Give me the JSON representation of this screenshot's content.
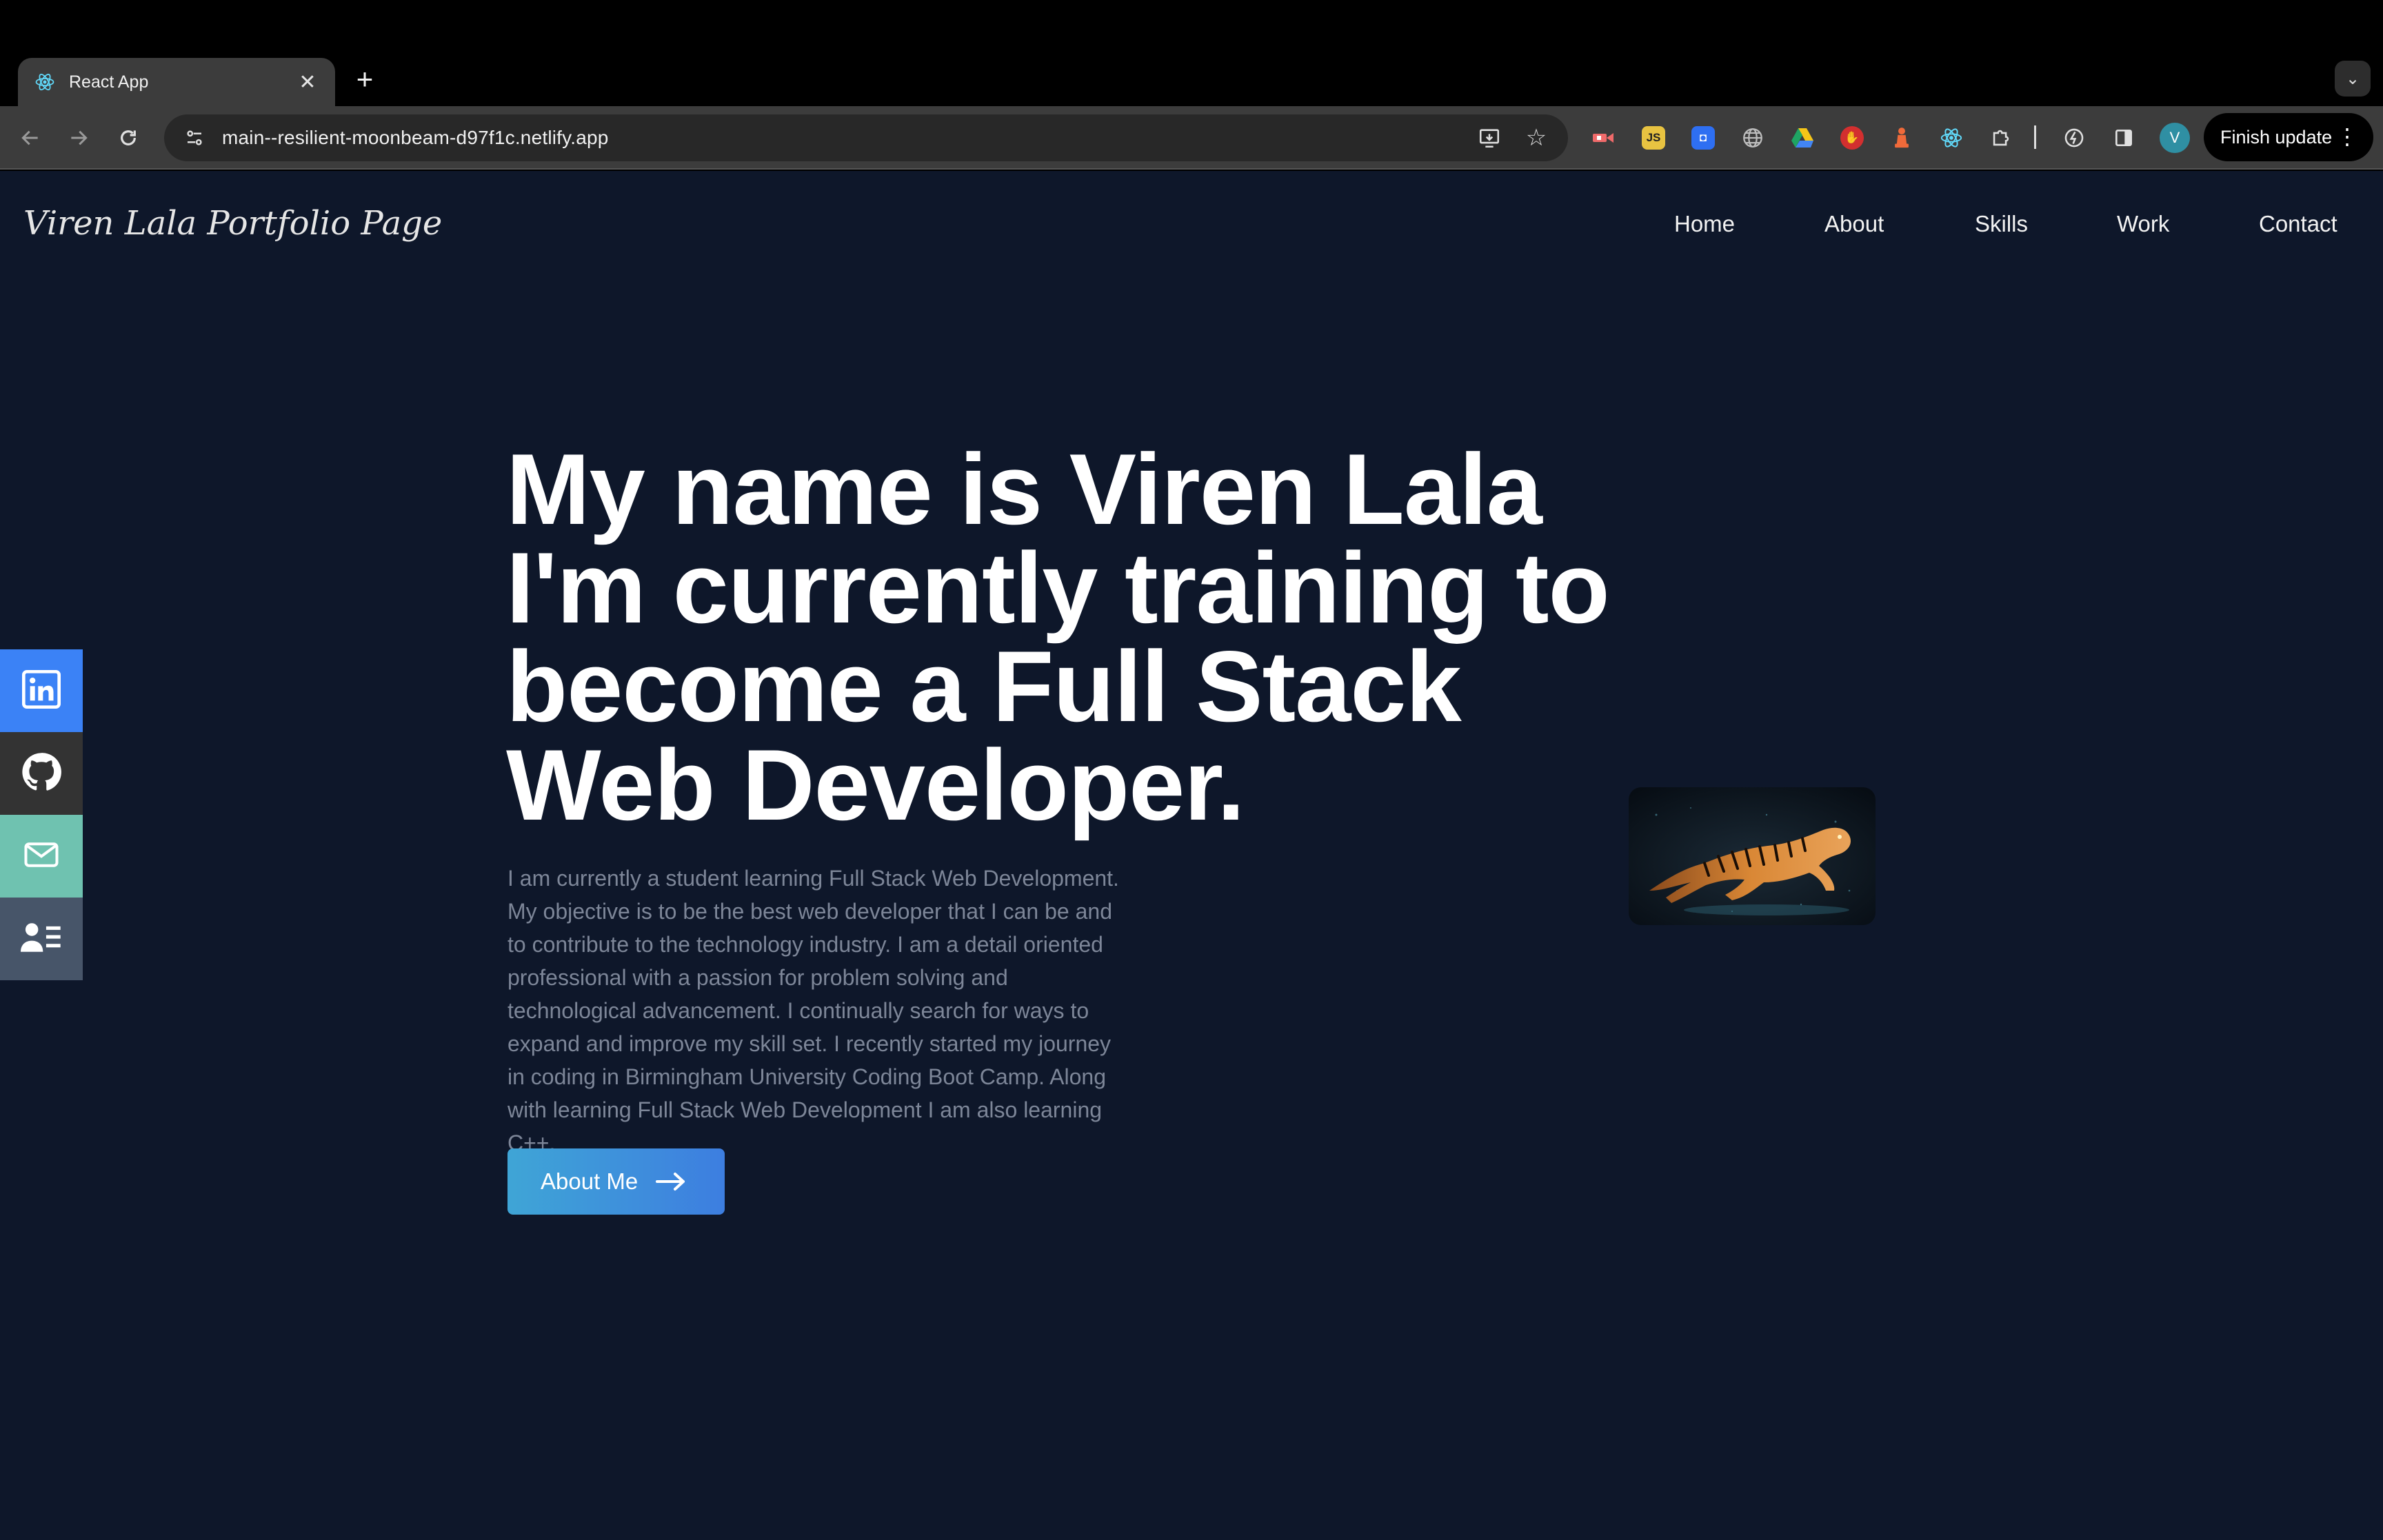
{
  "browser": {
    "tab": {
      "title": "React App",
      "favicon": "react-icon"
    },
    "url": "main--resilient-moonbeam-d97f1c.netlify.app",
    "finish_update_label": "Finish update",
    "avatar_letter": "V",
    "extensions": [
      "video-ext-icon",
      "js-ext-icon",
      "bitwarden-icon",
      "globe-icon",
      "drive-icon",
      "shield-ext-icon",
      "chess-icon",
      "react-devtools-icon",
      "puzzle-icon"
    ]
  },
  "site": {
    "brand": "Viren Lala Portfolio Page",
    "nav": [
      "Home",
      "About",
      "Skills",
      "Work",
      "Contact"
    ],
    "hero": {
      "lines": [
        "My name is Viren Lala",
        "I'm currently training to",
        "become a Full Stack",
        "Web Developer."
      ],
      "description": "I am currently a student learning Full Stack Web Development. My objective is to be the best web developer that I can be and to contribute to the technology industry. I am a detail oriented professional with a passion for problem solving and technological advancement. I continually search for ways to expand and improve my skill set. I recently started my journey in coding in Birmingham University Coding Boot Camp. Along with learning Full Stack Web Development I am also learning C++.",
      "cta_label": "About Me"
    },
    "social": [
      {
        "name": "linkedin-icon",
        "color": "#3b82f6"
      },
      {
        "name": "github-icon",
        "color": "#333333"
      },
      {
        "name": "mail-icon",
        "color": "#6fc2b0"
      },
      {
        "name": "resume-icon",
        "color": "#475569"
      }
    ]
  }
}
